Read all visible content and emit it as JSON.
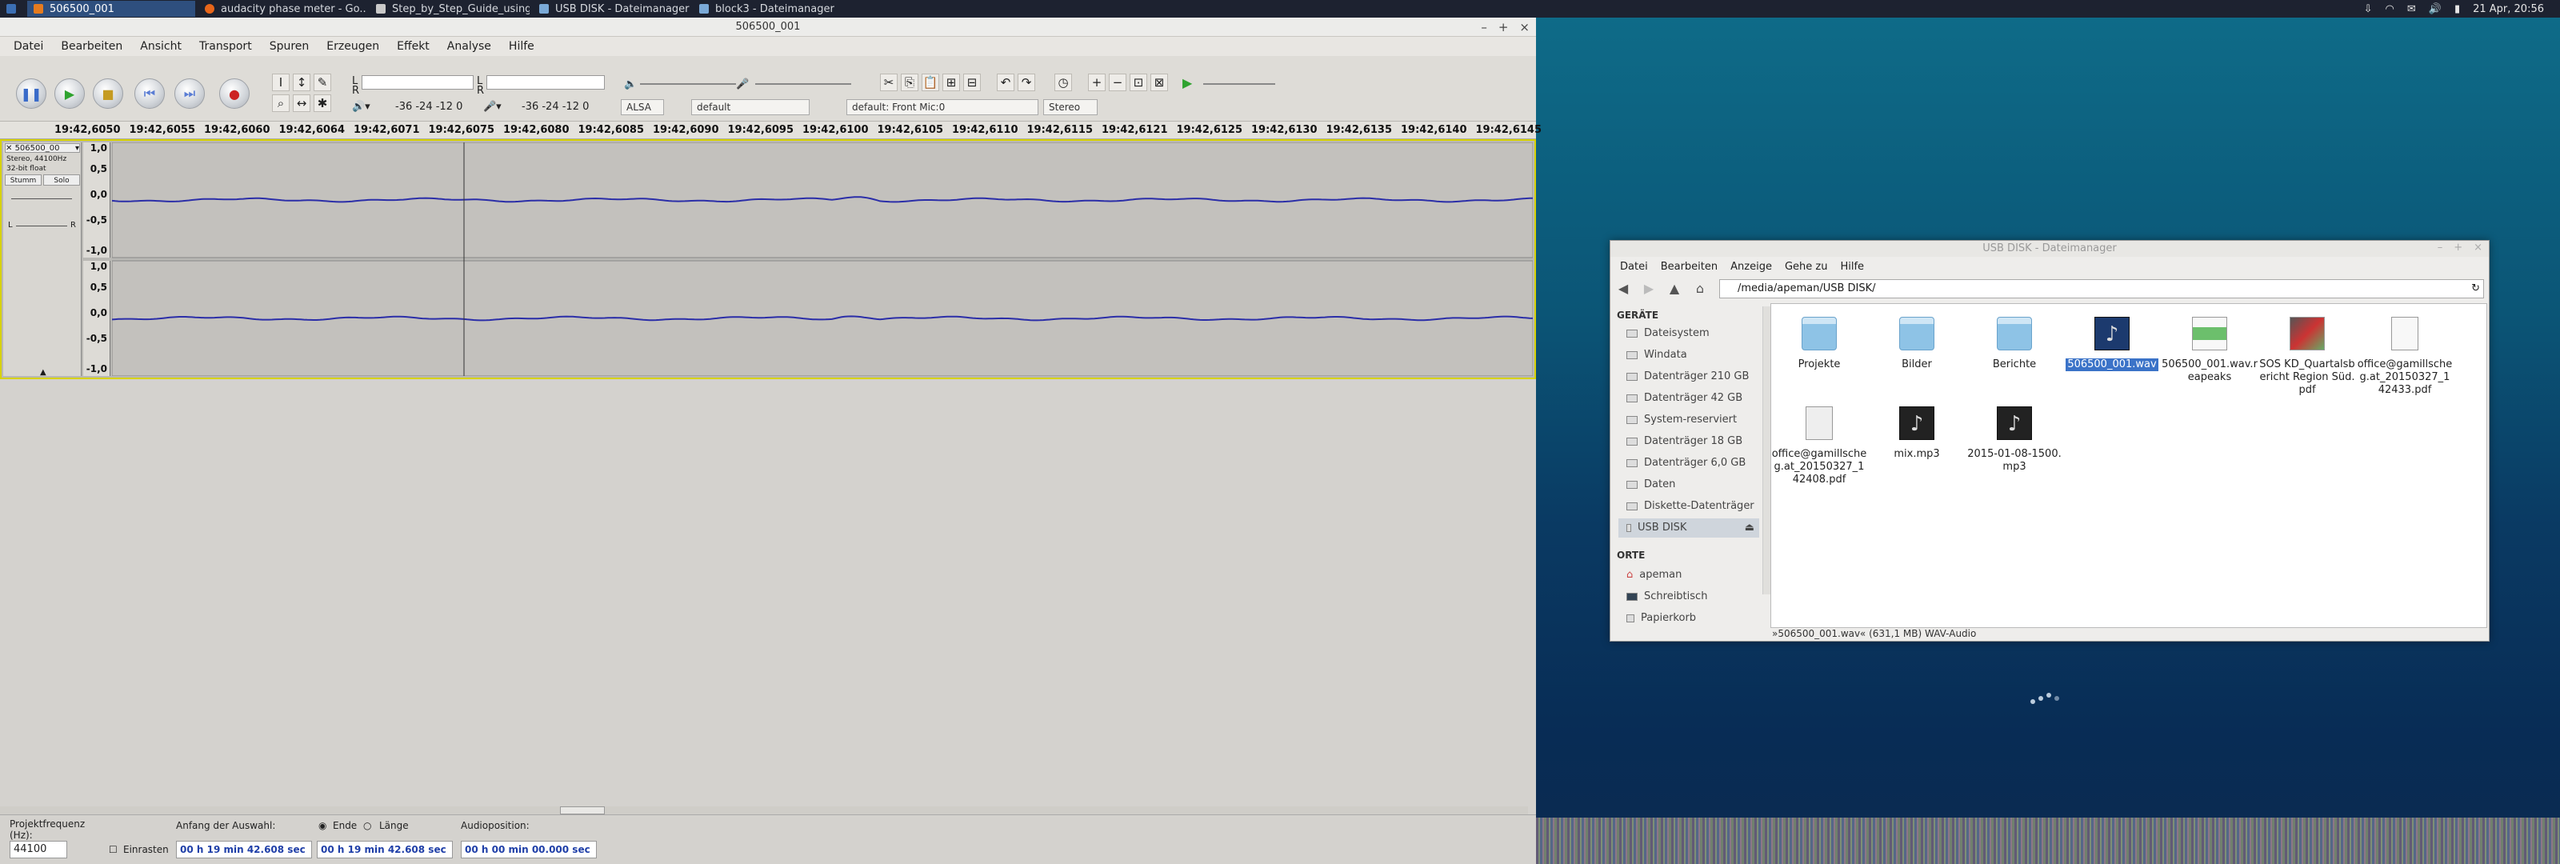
{
  "taskbar": {
    "tasks": [
      "506500_001",
      "audacity phase meter - Go...",
      "Step_by_Step_Guide_using...",
      "USB DISK - Dateimanager",
      "block3 - Dateimanager"
    ],
    "clock": "21 Apr, 20:56"
  },
  "audacity": {
    "title": "506500_001",
    "menu": [
      "Datei",
      "Bearbeiten",
      "Ansicht",
      "Transport",
      "Spuren",
      "Erzeugen",
      "Effekt",
      "Analyse",
      "Hilfe"
    ],
    "meter_ticks_rec": "-36  -24  -12   0",
    "meter_ticks_play": "-36  -24  -12   0",
    "meter_l": "L",
    "meter_r": "R",
    "device_host": "ALSA",
    "device_play": "default",
    "device_rec": "default: Front Mic:0",
    "channels": "Stereo",
    "ruler": [
      "19:42,6050",
      "19:42,6055",
      "19:42,6060",
      "19:42,6064",
      "19:42,6071",
      "19:42,6075",
      "19:42,6080",
      "19:42,6085",
      "19:42,6090",
      "19:42,6095",
      "19:42,6100",
      "19:42,6105",
      "19:42,6110",
      "19:42,6115",
      "19:42,6121",
      "19:42,6125",
      "19:42,6130",
      "19:42,6135",
      "19:42,6140",
      "19:42,6145"
    ],
    "track": {
      "name": "506500_00",
      "info1": "Stereo, 44100Hz",
      "info2": "32-bit float",
      "mute": "Stumm",
      "solo": "Solo",
      "pan_l": "L",
      "pan_r": "R"
    },
    "scale": [
      "1,0",
      "0,5",
      "0,0",
      "-0,5",
      "-1,0"
    ],
    "bottom": {
      "rate_label": "Projektfrequenz (Hz):",
      "rate_value": "44100",
      "snap_label": "Einrasten",
      "sel_start_label": "Anfang der Auswahl:",
      "end_label": "Ende",
      "length_label": "Länge",
      "audio_pos_label": "Audioposition:",
      "sel_start": "00 h 19 min 42.608 sec",
      "sel_end": "00 h 19 min 42.608 sec",
      "audio_pos": "00 h 00 min 00.000 sec"
    }
  },
  "filemanager": {
    "title": "USB DISK - Dateimanager",
    "menu": [
      "Datei",
      "Bearbeiten",
      "Anzeige",
      "Gehe zu",
      "Hilfe"
    ],
    "path": "/media/apeman/USB DISK/",
    "side_head_devices": "GERÄTE",
    "side_devices": [
      "Dateisystem",
      "Windata",
      "Datenträger 210 GB",
      "Datenträger 42 GB",
      "System-reserviert",
      "Datenträger 18 GB",
      "Datenträger 6,0 GB",
      "Daten",
      "Diskette-Datenträger",
      "USB DISK"
    ],
    "side_head_places": "ORTE",
    "side_places": [
      "apeman",
      "Schreibtisch",
      "Papierkorb"
    ],
    "files": [
      "Projekte",
      "Bilder",
      "Berichte",
      "506500_001.wav",
      "506500_001.wav.reapeaks",
      "SOS KD_Quartalsbericht Region Süd.pdf",
      "office@gamillscheg.at_20150327_142433.pdf",
      "office@gamillscheg.at_20150327_142408.pdf",
      "mix.mp3",
      "2015-01-08-1500.mp3"
    ],
    "status": "»506500_001.wav« (631,1 MB) WAV-Audio"
  }
}
